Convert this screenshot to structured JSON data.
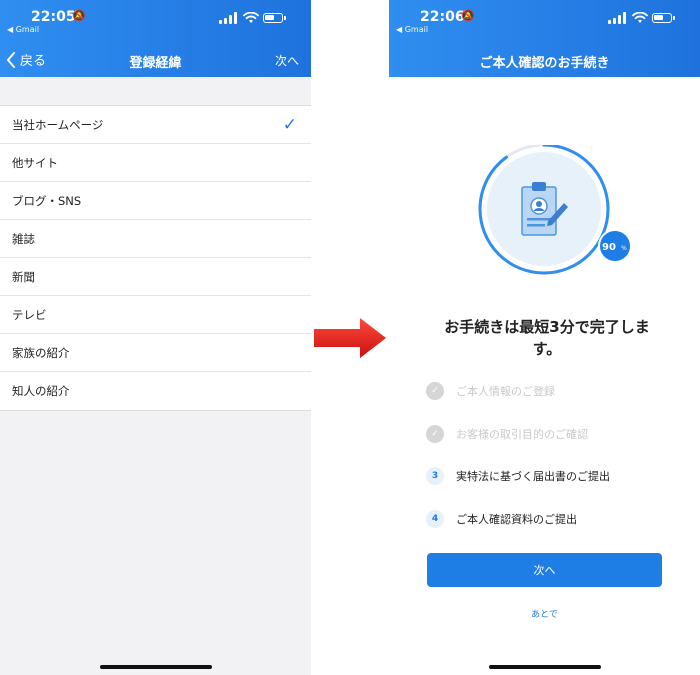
{
  "left_screen": {
    "status": {
      "time": "22:05",
      "back_app": "◀ Gmail"
    },
    "nav": {
      "back_label": "戻る",
      "title": "登録経緯",
      "next_label": "次へ"
    },
    "options": [
      {
        "label": "当社ホームページ",
        "selected": true
      },
      {
        "label": "他サイト",
        "selected": false
      },
      {
        "label": "ブログ・SNS",
        "selected": false
      },
      {
        "label": "雑誌",
        "selected": false
      },
      {
        "label": "新聞",
        "selected": false
      },
      {
        "label": "テレビ",
        "selected": false
      },
      {
        "label": "家族の紹介",
        "selected": false
      },
      {
        "label": "知人の紹介",
        "selected": false
      }
    ]
  },
  "right_screen": {
    "status": {
      "time": "22:06",
      "back_app": "◀ Gmail"
    },
    "nav": {
      "title": "ご本人確認のお手続き"
    },
    "progress": {
      "value": 90,
      "label_number": "90",
      "label_unit": "%"
    },
    "headline_line1": "お手続きは最短3分で完了しま",
    "headline_line2": "す。",
    "steps": [
      {
        "badge": "✓",
        "label": "ご本人情報のご登録",
        "done": true
      },
      {
        "badge": "✓",
        "label": "お客様の取引目的のご確認",
        "done": true
      },
      {
        "badge": "3",
        "label": "実特法に基づく届出書のご提出",
        "done": false
      },
      {
        "badge": "4",
        "label": "ご本人確認資料のご提出",
        "done": false
      }
    ],
    "next_button": "次へ",
    "later_link": "あとで"
  },
  "colors": {
    "accent": "#1f7ee5",
    "header_gradient_start": "#2f8ef0",
    "header_gradient_end": "#1f72dd",
    "arrow": "#e02020"
  },
  "icons": [
    "chevron-left-icon",
    "checkmark-icon",
    "bell-slash-icon",
    "signal-icon",
    "wifi-icon",
    "battery-icon",
    "clipboard-profile-icon",
    "red-arrow-icon"
  ]
}
